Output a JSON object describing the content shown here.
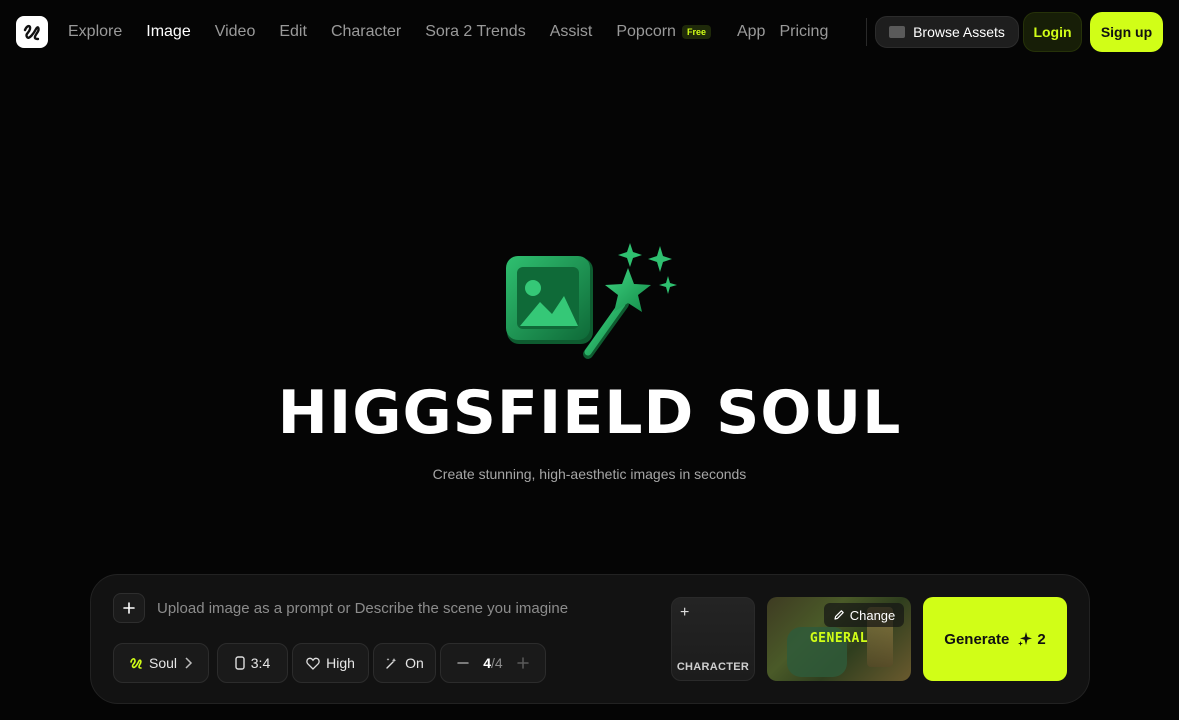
{
  "header": {
    "nav": [
      {
        "label": "Explore",
        "active": false
      },
      {
        "label": "Image",
        "active": true
      },
      {
        "label": "Video",
        "active": false
      },
      {
        "label": "Edit",
        "active": false
      },
      {
        "label": "Character",
        "active": false
      },
      {
        "label": "Sora 2 Trends",
        "active": false
      },
      {
        "label": "Assist",
        "active": false
      },
      {
        "label": "Popcorn",
        "active": false,
        "badge": "Free"
      },
      {
        "label": "App",
        "active": false
      },
      {
        "label": "Pricing",
        "active": false
      }
    ],
    "browse_label": "Browse Assets",
    "login_label": "Login",
    "signup_label": "Sign up"
  },
  "hero": {
    "title": "HIGGSFIELD SOUL",
    "subtitle": "Create stunning, high-aesthetic images in seconds"
  },
  "prompt": {
    "placeholder": "Upload image as a prompt or Describe the scene you imagine",
    "value": ""
  },
  "settings": {
    "model": "Soul",
    "aspect_ratio": "3:4",
    "quality": "High",
    "enhance": "On",
    "count": "4",
    "count_total": "/4"
  },
  "character": {
    "label": "CHARACTER"
  },
  "style": {
    "label": "GENERAL",
    "change_label": "Change"
  },
  "generate": {
    "label": "Generate",
    "cost": "2"
  },
  "colors": {
    "accent": "#d1fe17",
    "background": "#050505",
    "hero_icon_green": "#1f9a55"
  },
  "icons": [
    "logo-icon",
    "folder-icon",
    "plus-icon",
    "soul-icon",
    "chevron-right-icon",
    "phone-ratio-icon",
    "heart-icon",
    "magic-wand-icon",
    "minus-icon",
    "pencil-icon",
    "sparkle-icon",
    "image-magic-icon"
  ]
}
